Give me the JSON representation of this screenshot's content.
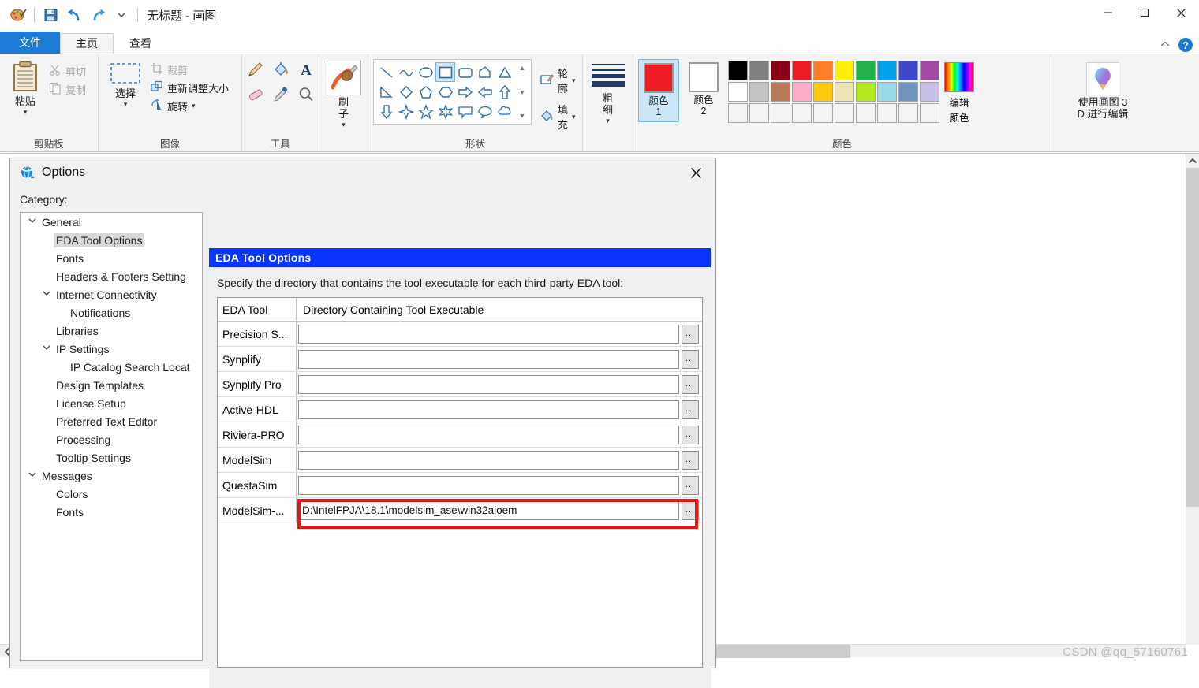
{
  "app": {
    "title": "无标题 - 画图",
    "quick_access": [
      "paint-logo",
      "save-icon",
      "undo-icon",
      "redo-icon",
      "customize-qat-caret"
    ],
    "window_controls": [
      "minimize",
      "maximize",
      "close"
    ]
  },
  "tabs": [
    {
      "label": "文件",
      "type": "file"
    },
    {
      "label": "主页",
      "type": "active"
    },
    {
      "label": "查看",
      "type": "normal"
    }
  ],
  "ribbon": {
    "collapse_icon": "chevron-up-icon",
    "help_label": "?",
    "groups": [
      {
        "name": "clipboard",
        "label": "剪贴板",
        "big_button": {
          "label": "粘贴",
          "icon": "paste-icon"
        },
        "small_items": [
          {
            "label": "剪切",
            "icon": "scissors-icon",
            "disabled": true
          },
          {
            "label": "复制",
            "icon": "copy-icon",
            "disabled": true
          }
        ]
      },
      {
        "name": "image",
        "label": "图像",
        "big_button": {
          "label": "选择",
          "icon": "select-rect-icon"
        },
        "small_items": [
          {
            "label": "裁剪",
            "icon": "crop-icon",
            "disabled": true
          },
          {
            "label": "重新调整大小",
            "icon": "resize-icon",
            "disabled": false
          },
          {
            "label": "旋转",
            "icon": "rotate-icon",
            "disabled": false
          }
        ]
      },
      {
        "name": "tools",
        "label": "工具",
        "tools": [
          "pencil-icon",
          "fill-bucket-icon",
          "text-icon",
          "eraser-icon",
          "color-picker-icon",
          "magnifier-icon"
        ]
      },
      {
        "name": "brushes",
        "label": "",
        "big_button": {
          "label": "刷子",
          "icon": "brush-icon"
        }
      },
      {
        "name": "shapes",
        "label": "形状",
        "selected_index": 3,
        "items": [
          "line",
          "curve",
          "oval",
          "rectangle",
          "rounded-rectangle",
          "polygon",
          "triangle",
          "right-triangle",
          "diamond",
          "pentagon",
          "hexagon",
          "right-arrow",
          "left-arrow",
          "up-arrow",
          "down-arrow",
          "four-point-star",
          "five-point-star",
          "six-point-star",
          "rounded-callout",
          "oval-callout",
          "cloud-callout"
        ],
        "outline": {
          "label": "轮廓",
          "icon": "outline-icon"
        },
        "fill": {
          "label": "填充",
          "icon": "fill-icon"
        }
      },
      {
        "name": "size",
        "label": "",
        "button": {
          "label": "粗细",
          "icon": "thickness-icon"
        }
      },
      {
        "name": "colors",
        "label": "颜色",
        "color1": {
          "label": "颜色 1",
          "value": "#ed1c24",
          "active": true
        },
        "color2": {
          "label": "颜色 2",
          "value": "#ffffff",
          "active": false
        },
        "palette_row1": [
          "#000000",
          "#7f7f7f",
          "#880015",
          "#ed1c24",
          "#ff7f27",
          "#fff200",
          "#22b14c",
          "#00a2e8",
          "#3f48cc",
          "#a349a4"
        ],
        "palette_row2": [
          "#ffffff",
          "#c3c3c3",
          "#b97a57",
          "#ffaec9",
          "#ffc90e",
          "#efe4b0",
          "#b5e61d",
          "#99d9ea",
          "#7092be",
          "#c8bfe7"
        ],
        "palette_row3": [
          "#f4f4f7",
          "#f4f4f7",
          "#f4f4f7",
          "#f4f4f7",
          "#f4f4f7",
          "#f4f4f7",
          "#f4f4f7",
          "#f4f4f7",
          "#f4f4f7",
          "#f4f4f7"
        ],
        "edit_colors": {
          "label_line1": "编辑",
          "label_line2": "颜色",
          "icon": "rainbow-icon"
        }
      },
      {
        "name": "paint3d",
        "label": "",
        "button": {
          "label_line1": "使用画图 3",
          "label_line2": "D 进行编辑",
          "icon": "paint3d-icon"
        }
      }
    ]
  },
  "dialog": {
    "title": "Options",
    "icon": "options-globe-icon",
    "close_icon": "close-icon",
    "category_label": "Category:",
    "tree": [
      {
        "label": "General",
        "level": 0,
        "expanded": true,
        "selected": false
      },
      {
        "label": "EDA Tool Options",
        "level": 1,
        "expanded": null,
        "selected": true
      },
      {
        "label": "Fonts",
        "level": 1,
        "expanded": null,
        "selected": false
      },
      {
        "label": "Headers & Footers Setting",
        "level": 1,
        "expanded": null,
        "selected": false
      },
      {
        "label": "Internet Connectivity",
        "level": 1,
        "expanded": true,
        "selected": false
      },
      {
        "label": "Notifications",
        "level": 2,
        "expanded": null,
        "selected": false
      },
      {
        "label": "Libraries",
        "level": 1,
        "expanded": null,
        "selected": false
      },
      {
        "label": "IP Settings",
        "level": 1,
        "expanded": true,
        "selected": false
      },
      {
        "label": "IP Catalog Search Locat",
        "level": 2,
        "expanded": null,
        "selected": false
      },
      {
        "label": "Design Templates",
        "level": 1,
        "expanded": null,
        "selected": false
      },
      {
        "label": "License Setup",
        "level": 1,
        "expanded": null,
        "selected": false
      },
      {
        "label": "Preferred Text Editor",
        "level": 1,
        "expanded": null,
        "selected": false
      },
      {
        "label": "Processing",
        "level": 1,
        "expanded": null,
        "selected": false
      },
      {
        "label": "Tooltip Settings",
        "level": 1,
        "expanded": null,
        "selected": false
      },
      {
        "label": "Messages",
        "level": 0,
        "expanded": true,
        "selected": false
      },
      {
        "label": "Colors",
        "level": 1,
        "expanded": null,
        "selected": false
      },
      {
        "label": "Fonts",
        "level": 1,
        "expanded": null,
        "selected": false
      }
    ],
    "panel": {
      "header": "EDA Tool Options",
      "description": "Specify the directory that contains the tool executable for each third-party EDA tool:",
      "columns": [
        "EDA Tool",
        "Directory Containing Tool Executable"
      ],
      "browse_label": "...",
      "rows": [
        {
          "tool": "Precision S...",
          "directory": "",
          "highlighted": false
        },
        {
          "tool": "Synplify",
          "directory": "",
          "highlighted": false
        },
        {
          "tool": "Synplify Pro",
          "directory": "",
          "highlighted": false
        },
        {
          "tool": "Active-HDL",
          "directory": "",
          "highlighted": false
        },
        {
          "tool": "Riviera-PRO",
          "directory": "",
          "highlighted": false
        },
        {
          "tool": "ModelSim",
          "directory": "",
          "highlighted": false
        },
        {
          "tool": "QuestaSim",
          "directory": "",
          "highlighted": false
        },
        {
          "tool": "ModelSim-...",
          "directory": "D:\\IntelFPJA\\18.1\\modelsim_ase\\win32aloem",
          "highlighted": true
        }
      ],
      "highlight_color": "#ee1111"
    }
  },
  "canvas": {
    "vscroll_arrow": "chevron-up-icon",
    "hscroll_arrow": "chevron-left-icon"
  },
  "watermark": "CSDN @qq_57160761"
}
